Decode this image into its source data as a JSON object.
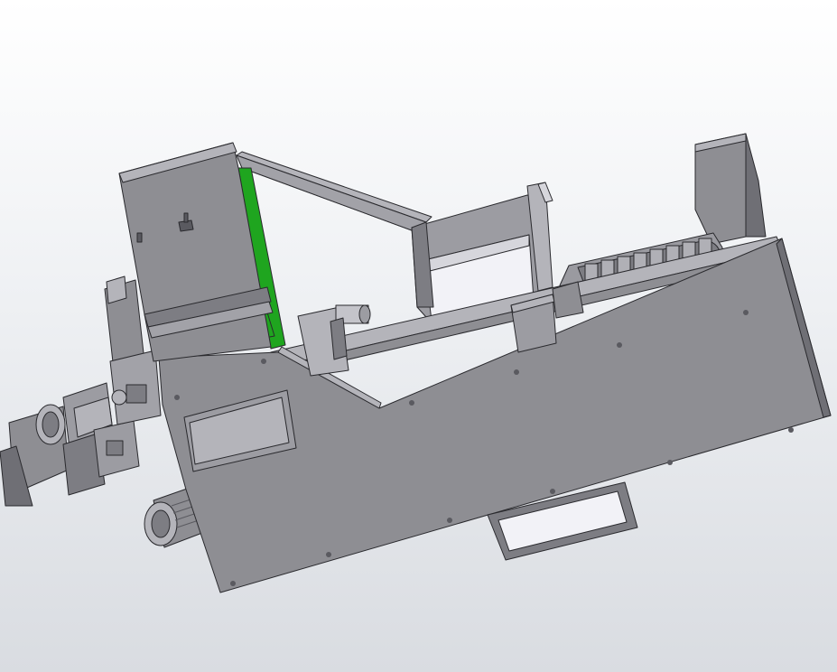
{
  "viewport": {
    "background_top": "#ffffff",
    "background_bottom": "#d9dce1"
  },
  "model": {
    "body_color": "#8e8e93",
    "body_dark_color": "#6f6f75",
    "body_light_color": "#b4b4ba",
    "edge_color": "#2a2a2e",
    "panel_white_color": "#f2f2f7",
    "highlight_green_color": "#1fa51f"
  }
}
